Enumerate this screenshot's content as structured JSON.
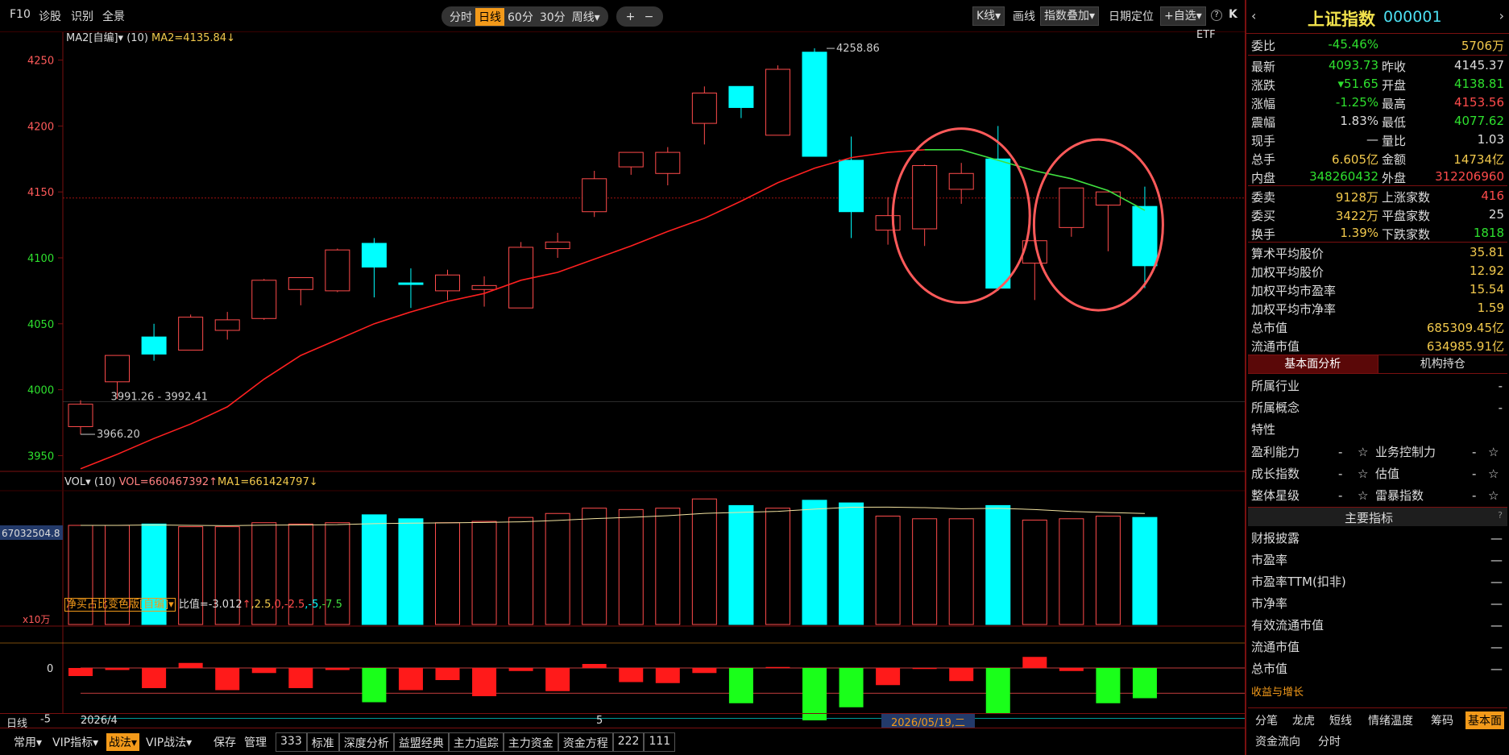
{
  "toolbar": {
    "left": [
      "F10",
      "诊股",
      "识别",
      "全景"
    ],
    "periods": [
      "分时",
      "日线",
      "60分",
      "30分",
      "周线▾"
    ],
    "active_period": "日线",
    "zoom_in": "+",
    "zoom_out": "−",
    "kline_btn": "K线▾",
    "draw_btn": "画线",
    "overlay_btn": "指数叠加▾",
    "date_locate": "日期定位",
    "add_fav": "+自选▾",
    "help": "?",
    "expand": "K"
  },
  "main_chart": {
    "indicator_name": "MA2[自编]▾",
    "indicator_params": "(10)",
    "indicator_value": "MA2=4135.84↓",
    "etf_label": "ETF",
    "price_labels": [
      "4250",
      "4200",
      "4150",
      "4100",
      "4050",
      "4000",
      "3950"
    ],
    "high_annotation": "4258.86",
    "low_annotation": "3966.20",
    "range_annotation": "3991.26 - 3992.41"
  },
  "vol_panel": {
    "name": "VOL▾",
    "params": "(10)",
    "vol_value": "VOL=660467392↑",
    "ma_value": "MA1=661424797↓",
    "side_value": "67032504.8",
    "unit": "x10万"
  },
  "ind3_panel": {
    "name": "净买占比变色版[自编]▾",
    "text_prefix": "比值=-3.012",
    "arrow": "↑",
    "levels": [
      ",2.5",
      ",0",
      ",-2.5",
      ",-5",
      ",-7.5"
    ],
    "y_labels": [
      "0",
      "-5"
    ]
  },
  "xaxis": {
    "period_label": "日线",
    "ticks": [
      "2026/4",
      "5"
    ],
    "cursor_date": "2026/05/19,二"
  },
  "chart_data": {
    "type": "candlestick",
    "ylim": [
      3935,
      4265
    ],
    "candles": [
      {
        "o": 3972,
        "c": 3989,
        "h": 3992,
        "l": 3966
      },
      {
        "o": 4006,
        "c": 4026,
        "h": 4026,
        "l": 3993
      },
      {
        "o": 4040,
        "c": 4027,
        "h": 4050,
        "l": 4022
      },
      {
        "o": 4030,
        "c": 4055,
        "h": 4057,
        "l": 4030
      },
      {
        "o": 4045,
        "c": 4053,
        "h": 4059,
        "l": 4038
      },
      {
        "o": 4054,
        "c": 4083,
        "h": 4084,
        "l": 4053
      },
      {
        "o": 4076,
        "c": 4085,
        "h": 4085,
        "l": 4064
      },
      {
        "o": 4075,
        "c": 4106,
        "h": 4107,
        "l": 4074
      },
      {
        "o": 4111,
        "c": 4093,
        "h": 4115,
        "l": 4070
      },
      {
        "o": 4081,
        "c": 4080,
        "h": 4092,
        "l": 4062
      },
      {
        "o": 4075,
        "c": 4087,
        "h": 4091,
        "l": 4068
      },
      {
        "o": 4076,
        "c": 4079,
        "h": 4086,
        "l": 4063
      },
      {
        "o": 4062,
        "c": 4108,
        "h": 4112,
        "l": 4062
      },
      {
        "o": 4107,
        "c": 4112,
        "h": 4119,
        "l": 4100
      },
      {
        "o": 4135,
        "c": 4160,
        "h": 4166,
        "l": 4131
      },
      {
        "o": 4169,
        "c": 4180,
        "h": 4180,
        "l": 4163
      },
      {
        "o": 4164,
        "c": 4180,
        "h": 4184,
        "l": 4155
      },
      {
        "o": 4202,
        "c": 4225,
        "h": 4230,
        "l": 4186
      },
      {
        "o": 4230,
        "c": 4214,
        "h": 4230,
        "l": 4206
      },
      {
        "o": 4193,
        "c": 4243,
        "h": 4246,
        "l": 4193
      },
      {
        "o": 4256,
        "c": 4177,
        "h": 4259,
        "l": 4177
      },
      {
        "o": 4174,
        "c": 4135,
        "h": 4192,
        "l": 4115
      },
      {
        "o": 4121,
        "c": 4132,
        "h": 4146,
        "l": 4110
      },
      {
        "o": 4122,
        "c": 4170,
        "h": 4171,
        "l": 4109
      },
      {
        "o": 4152,
        "c": 4164,
        "h": 4172,
        "l": 4141
      },
      {
        "o": 4175,
        "c": 4077,
        "h": 4200,
        "l": 4075
      },
      {
        "o": 4096,
        "c": 4113,
        "h": 4120,
        "l": 4068
      },
      {
        "o": 4123,
        "c": 4153,
        "h": 4153,
        "l": 4116
      },
      {
        "o": 4140,
        "c": 4150,
        "h": 4151,
        "l": 4105
      },
      {
        "o": 4139,
        "c": 4094,
        "h": 4154,
        "l": 4077
      }
    ],
    "ma": [
      3940,
      3951,
      3963,
      3974,
      3987,
      4008,
      4026,
      4038,
      4050,
      4059,
      4067,
      4073,
      4083,
      4089,
      4099,
      4109,
      4120,
      4130,
      4143,
      4157,
      4168,
      4176,
      4180,
      4182,
      4182,
      4174,
      4166,
      4160,
      4151,
      4136
    ],
    "volume": [
      75,
      75,
      76,
      74,
      74,
      77,
      76,
      77,
      83,
      80,
      77,
      78,
      81,
      84,
      88,
      87,
      88,
      95,
      90,
      88,
      94,
      92,
      82,
      80,
      80,
      90,
      79,
      80,
      82,
      81
    ],
    "net_ratio": [
      -0.8,
      -0.2,
      -2.0,
      0.5,
      -2.2,
      -0.5,
      -2.0,
      -0.2,
      -3.4,
      -2.2,
      -1.2,
      -2.8,
      -0.3,
      -2.3,
      0.4,
      -1.4,
      -1.5,
      -0.5,
      -3.5,
      0.1,
      -5.2,
      -3.9,
      -1.7,
      -0.1,
      -1.3,
      -4.5,
      1.1,
      -0.3,
      -3.5,
      -3.0
    ]
  },
  "right_panel": {
    "title": "上证指数",
    "code": "000001",
    "weibi": {
      "label": "委比",
      "value": "-45.46%",
      "extra": "5706万"
    },
    "rows": [
      {
        "k": "最新",
        "v": "4093.73",
        "vc": "#2ee02e",
        "k2": "昨收",
        "v2": "4145.37",
        "v2c": "#ddd"
      },
      {
        "k": "涨跌",
        "v": "▾51.65",
        "vc": "#2ee02e",
        "k2": "开盘",
        "v2": "4138.81",
        "v2c": "#2ee02e"
      },
      {
        "k": "涨幅",
        "v": "-1.25%",
        "vc": "#2ee02e",
        "k2": "最高",
        "v2": "4153.56",
        "v2c": "#ff4b4b"
      },
      {
        "k": "震幅",
        "v": "1.83%",
        "vc": "#ddd",
        "k2": "最低",
        "v2": "4077.62",
        "v2c": "#2ee02e"
      },
      {
        "k": "现手",
        "v": "—",
        "vc": "#ddd",
        "k2": "量比",
        "v2": "1.03",
        "v2c": "#ddd"
      },
      {
        "k": "总手",
        "v": "6.605亿",
        "vc": "#f2c94c",
        "k2": "金额",
        "v2": "14734亿",
        "v2c": "#f2c94c"
      },
      {
        "k": "内盘",
        "v": "348260432",
        "vc": "#2ee02e",
        "k2": "外盘",
        "v2": "312206960",
        "v2c": "#ff4b4b"
      }
    ],
    "rows2": [
      {
        "k": "委卖",
        "v": "9128万",
        "vc": "#f2c94c",
        "k2": "上涨家数",
        "v2": "416",
        "v2c": "#ff4b4b"
      },
      {
        "k": "委买",
        "v": "3422万",
        "vc": "#f2c94c",
        "k2": "平盘家数",
        "v2": "25",
        "v2c": "#ddd"
      },
      {
        "k": "换手",
        "v": "1.39%",
        "vc": "#f2c94c",
        "k2": "下跌家数",
        "v2": "1818",
        "v2c": "#2ee02e"
      }
    ],
    "rows3": [
      {
        "k": "算术平均股价",
        "v": "35.81"
      },
      {
        "k": "加权平均股价",
        "v": "12.92"
      },
      {
        "k": "加权平均市盈率",
        "v": "15.54"
      },
      {
        "k": "加权平均市净率",
        "v": "1.59"
      },
      {
        "k": "总市值",
        "v": "685309.45亿"
      },
      {
        "k": "流通市值",
        "v": "634985.91亿"
      }
    ],
    "tab_fundamental": "基本面分析",
    "tab_institution": "机构持仓",
    "fundamental_items": [
      "所属行业",
      "所属概念",
      "特性"
    ],
    "star_rows": [
      {
        "k": "盈利能力",
        "k2": "业务控制力"
      },
      {
        "k": "成长指数",
        "k2": "估值"
      },
      {
        "k": "整体星级",
        "k2": "雷暴指数"
      }
    ],
    "dash": "-",
    "star": "☆",
    "main_indicators_title": "主要指标",
    "indicator_items": [
      "财报披露",
      "市盈率",
      "市盈率TTM(扣非)",
      "市净率",
      "有效流通市值",
      "流通市值",
      "总市值"
    ],
    "indicator_dash": "—",
    "growth_label": "收益与增长",
    "bottom_tabs": [
      "分笔",
      "龙虎",
      "短线",
      "情绪温度",
      "筹码",
      "基本面"
    ],
    "bottom_tabs2": [
      "资金流向",
      "分时"
    ],
    "active_bottom_tab": "基本面"
  },
  "bottom_bar": {
    "items": [
      "常用▾",
      "VIP指标▾",
      "战法▾",
      "VIP战法▾",
      "保存",
      "管理"
    ],
    "tabs": [
      "333",
      "标准",
      "深度分析",
      "益盟经典",
      "主力追踪",
      "主力资金",
      "资金方程",
      "222",
      "111"
    ]
  },
  "colors": {
    "up": "#ff4b4b",
    "down": "#00ffff",
    "ma": "#ff2020",
    "ma_down": "#40e040",
    "highlight_circle": "#ff5a5a"
  }
}
